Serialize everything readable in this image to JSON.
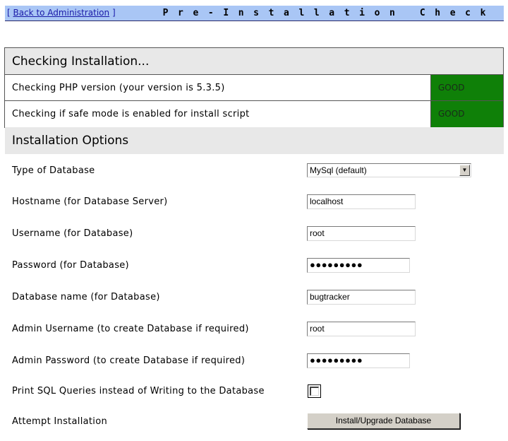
{
  "header": {
    "back_open": "[ ",
    "back_link": "Back to Administration",
    "back_close": " ]",
    "title": "Pre-Installation Check"
  },
  "checking": {
    "title": "Checking Installation...",
    "rows": [
      {
        "label": "Checking PHP version (your version is 5.3.5)",
        "status": "GOOD"
      },
      {
        "label": "Checking if safe mode is enabled for install script",
        "status": "GOOD"
      }
    ],
    "status_color": "#0f8008"
  },
  "options": {
    "title": "Installation Options",
    "db_type_label": "Type of Database",
    "db_type_value": "MySql (default)",
    "hostname_label": "Hostname (for Database Server)",
    "hostname_value": "localhost",
    "username_label": "Username (for Database)",
    "username_value": "root",
    "password_label": "Password (for Database)",
    "password_value": "●●●●●●●●●",
    "dbname_label": "Database name (for Database)",
    "dbname_value": "bugtracker",
    "admin_user_label": "Admin Username (to create Database if required)",
    "admin_user_value": "root",
    "admin_pw_label": "Admin Password (to create Database if required)",
    "admin_pw_value": "●●●●●●●●●",
    "print_sql_label": "Print SQL Queries instead of Writing to the Database",
    "print_sql_checked": false,
    "attempt_label": "Attempt Installation",
    "install_button": "Install/Upgrade Database"
  }
}
